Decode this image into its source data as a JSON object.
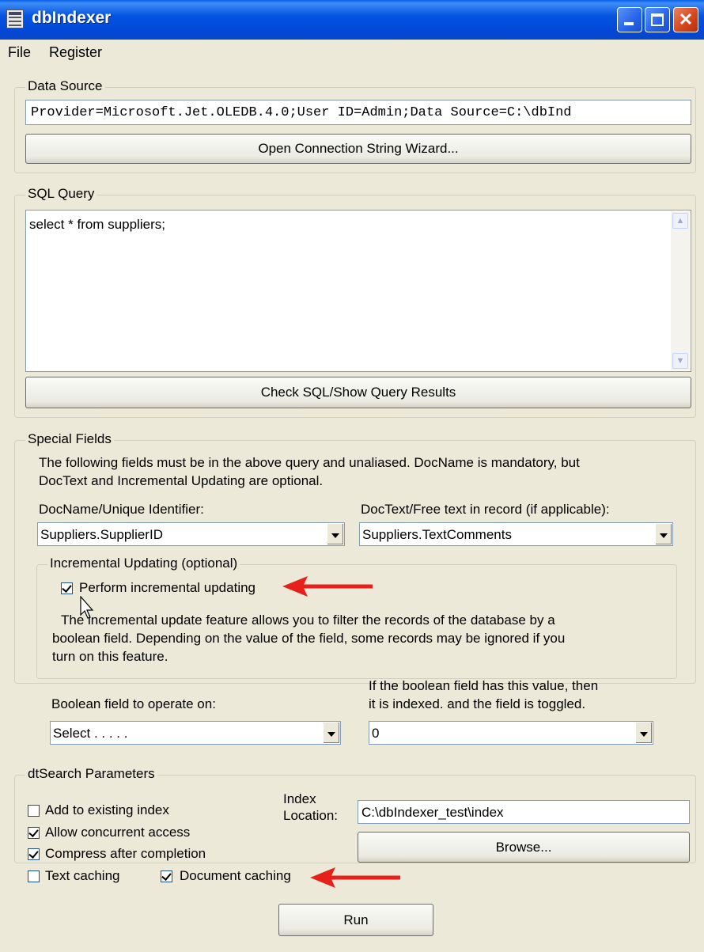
{
  "window": {
    "title": "dbIndexer"
  },
  "menu": [
    "File",
    "Register"
  ],
  "data_source": {
    "legend": "Data Source",
    "connection_string": "Provider=Microsoft.Jet.OLEDB.4.0;User ID=Admin;Data Source=C:\\dbInd",
    "wizard_button": "Open Connection String Wizard..."
  },
  "sql_query": {
    "legend": "SQL Query",
    "query": "select * from suppliers;",
    "check_button": "Check SQL/Show Query Results"
  },
  "special_fields": {
    "legend": "Special Fields",
    "description_line1": "The following fields must be in the above query and unaliased.  DocName is mandatory, but",
    "description_line2": "DocText and Incremental Updating are optional.",
    "docname_label": "DocName/Unique Identifier:",
    "docname_value": "Suppliers.SupplierID",
    "doctext_label": "DocText/Free text in record (if applicable):",
    "doctext_value": "Suppliers.TextComments",
    "incremental": {
      "legend": "Incremental Updating (optional)",
      "checkbox_label": "Perform incremental updating",
      "checked": true,
      "desc_line1": "The incremental update feature allows you to filter the records of the database by a",
      "desc_line2": "boolean field.  Depending on the value of the field, some records may be ignored if you",
      "desc_line3": "turn on this feature.",
      "boolean_field_label": "Boolean field to operate on:",
      "boolean_field_value": "Select . . . . .",
      "value_label_line1": "If the boolean field has this value, then",
      "value_label_line2": "it is indexed. and the field is toggled.",
      "value_value": "0"
    }
  },
  "dtsearch": {
    "legend": "dtSearch Parameters",
    "add_existing": {
      "label": "Add to existing index",
      "checked": false
    },
    "allow_concurrent": {
      "label": "Allow concurrent access",
      "checked": true
    },
    "compress": {
      "label": "Compress after completion",
      "checked": true
    },
    "text_caching": {
      "label": "Text caching",
      "checked": false
    },
    "document_caching": {
      "label": "Document caching",
      "checked": true
    },
    "index_location_label_line1": "Index",
    "index_location_label_line2": "Location:",
    "index_location_value": "C:\\dbIndexer_test\\index",
    "browse_button": "Browse..."
  },
  "run_button": "Run",
  "colors": {
    "annotation_arrow": "#e8201b",
    "titlebar": "#0553e0"
  }
}
